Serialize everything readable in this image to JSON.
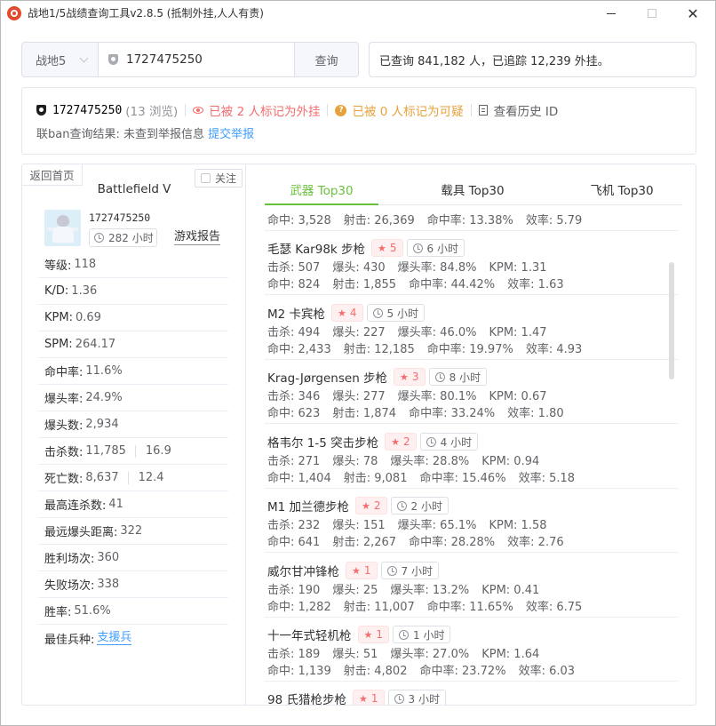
{
  "window": {
    "title": "战地1/5战绩查询工具v2.8.5 (抵制外挂,人人有责)"
  },
  "search": {
    "game": "战地5",
    "value": "1727475250",
    "button": "查询"
  },
  "stats_summary": "已查询 841,182 人，已追踪 12,239 外挂。",
  "player": {
    "id": "1727475250",
    "views": "(13 浏览)",
    "marked_cheater": "已被 2 人标记为外挂",
    "marked_suspicious": "已被 0 人标记为可疑",
    "history": "查看历史 ID",
    "ban_result": "联ban查询结果: 未查到举报信息",
    "report_link": "提交举报"
  },
  "left": {
    "back": "返回首页",
    "follow": "关注",
    "game_title": "Battlefield V",
    "profile_id": "1727475250",
    "hours": "282 小时",
    "report": "游戏报告",
    "stats": [
      {
        "label": "等级:",
        "value": "118"
      },
      {
        "label": "K/D:",
        "value": "1.36"
      },
      {
        "label": "KPM:",
        "value": "0.69"
      },
      {
        "label": "SPM:",
        "value": "264.17"
      },
      {
        "label": "命中率:",
        "value": "11.6%"
      },
      {
        "label": "爆头率:",
        "value": "24.9%"
      },
      {
        "label": "爆头数:",
        "value": "2,934"
      },
      {
        "label": "击杀数:",
        "value": "11,785",
        "extra": "16.9"
      },
      {
        "label": "死亡数:",
        "value": "8,637",
        "extra": "12.4"
      },
      {
        "label": "最高连杀数:",
        "value": "41"
      },
      {
        "label": "最远爆头距离:",
        "value": "322"
      },
      {
        "label": "胜利场次:",
        "value": "360"
      },
      {
        "label": "失败场次:",
        "value": "338"
      },
      {
        "label": "胜率:",
        "value": "51.6%"
      },
      {
        "label": "最佳兵种:",
        "value": "支援兵"
      }
    ]
  },
  "tabs": [
    "武器 Top30",
    "载具 Top30",
    "飞机 Top30"
  ],
  "partial_top": {
    "hits": "命中: 3,528",
    "shots": "射击: 26,369",
    "acc": "命中率: 13.38%",
    "eff": "效率: 5.79"
  },
  "weapons": [
    {
      "name": "毛瑟 Kar98k 步枪",
      "stars": "5",
      "time": "6 小时",
      "kills": "击杀: 507",
      "hs": "爆头: 430",
      "hsr": "爆头率: 84.8%",
      "kpm": "KPM: 1.31",
      "hits": "命中: 824",
      "shots": "射击: 1,855",
      "acc": "命中率: 44.42%",
      "eff": "效率: 1.63"
    },
    {
      "name": "M2 卡宾枪",
      "stars": "4",
      "time": "5 小时",
      "kills": "击杀: 494",
      "hs": "爆头: 227",
      "hsr": "爆头率: 46.0%",
      "kpm": "KPM: 1.47",
      "hits": "命中: 2,433",
      "shots": "射击: 12,185",
      "acc": "命中率: 19.97%",
      "eff": "效率: 4.93"
    },
    {
      "name": "Krag-Jørgensen 步枪",
      "stars": "3",
      "time": "8 小时",
      "kills": "击杀: 346",
      "hs": "爆头: 277",
      "hsr": "爆头率: 80.1%",
      "kpm": "KPM: 0.67",
      "hits": "命中: 623",
      "shots": "射击: 1,874",
      "acc": "命中率: 33.24%",
      "eff": "效率: 1.80"
    },
    {
      "name": "格韦尔 1-5 突击步枪",
      "stars": "2",
      "time": "4 小时",
      "kills": "击杀: 271",
      "hs": "爆头: 78",
      "hsr": "爆头率: 28.8%",
      "kpm": "KPM: 0.94",
      "hits": "命中: 1,404",
      "shots": "射击: 9,081",
      "acc": "命中率: 15.46%",
      "eff": "效率: 5.18"
    },
    {
      "name": "M1 加兰德步枪",
      "stars": "2",
      "time": "2 小时",
      "kills": "击杀: 232",
      "hs": "爆头: 151",
      "hsr": "爆头率: 65.1%",
      "kpm": "KPM: 1.58",
      "hits": "命中: 641",
      "shots": "射击: 2,267",
      "acc": "命中率: 28.28%",
      "eff": "效率: 2.76"
    },
    {
      "name": "威尔甘冲锋枪",
      "stars": "1",
      "time": "7 小时",
      "kills": "击杀: 190",
      "hs": "爆头: 25",
      "hsr": "爆头率: 13.2%",
      "kpm": "KPM: 0.41",
      "hits": "命中: 1,282",
      "shots": "射击: 11,007",
      "acc": "命中率: 11.65%",
      "eff": "效率: 6.75"
    },
    {
      "name": "十一年式轻机枪",
      "stars": "1",
      "time": "1 小时",
      "kills": "击杀: 189",
      "hs": "爆头: 51",
      "hsr": "爆头率: 27.0%",
      "kpm": "KPM: 1.64",
      "hits": "命中: 1,139",
      "shots": "射击: 4,802",
      "acc": "命中率: 23.72%",
      "eff": "效率: 6.03"
    },
    {
      "name": "98 氏猎枪步枪",
      "stars": "1",
      "time": "3 小时",
      "kills": "",
      "hs": "",
      "hsr": "",
      "kpm": "",
      "hits": "",
      "shots": "",
      "acc": "",
      "eff": ""
    }
  ]
}
